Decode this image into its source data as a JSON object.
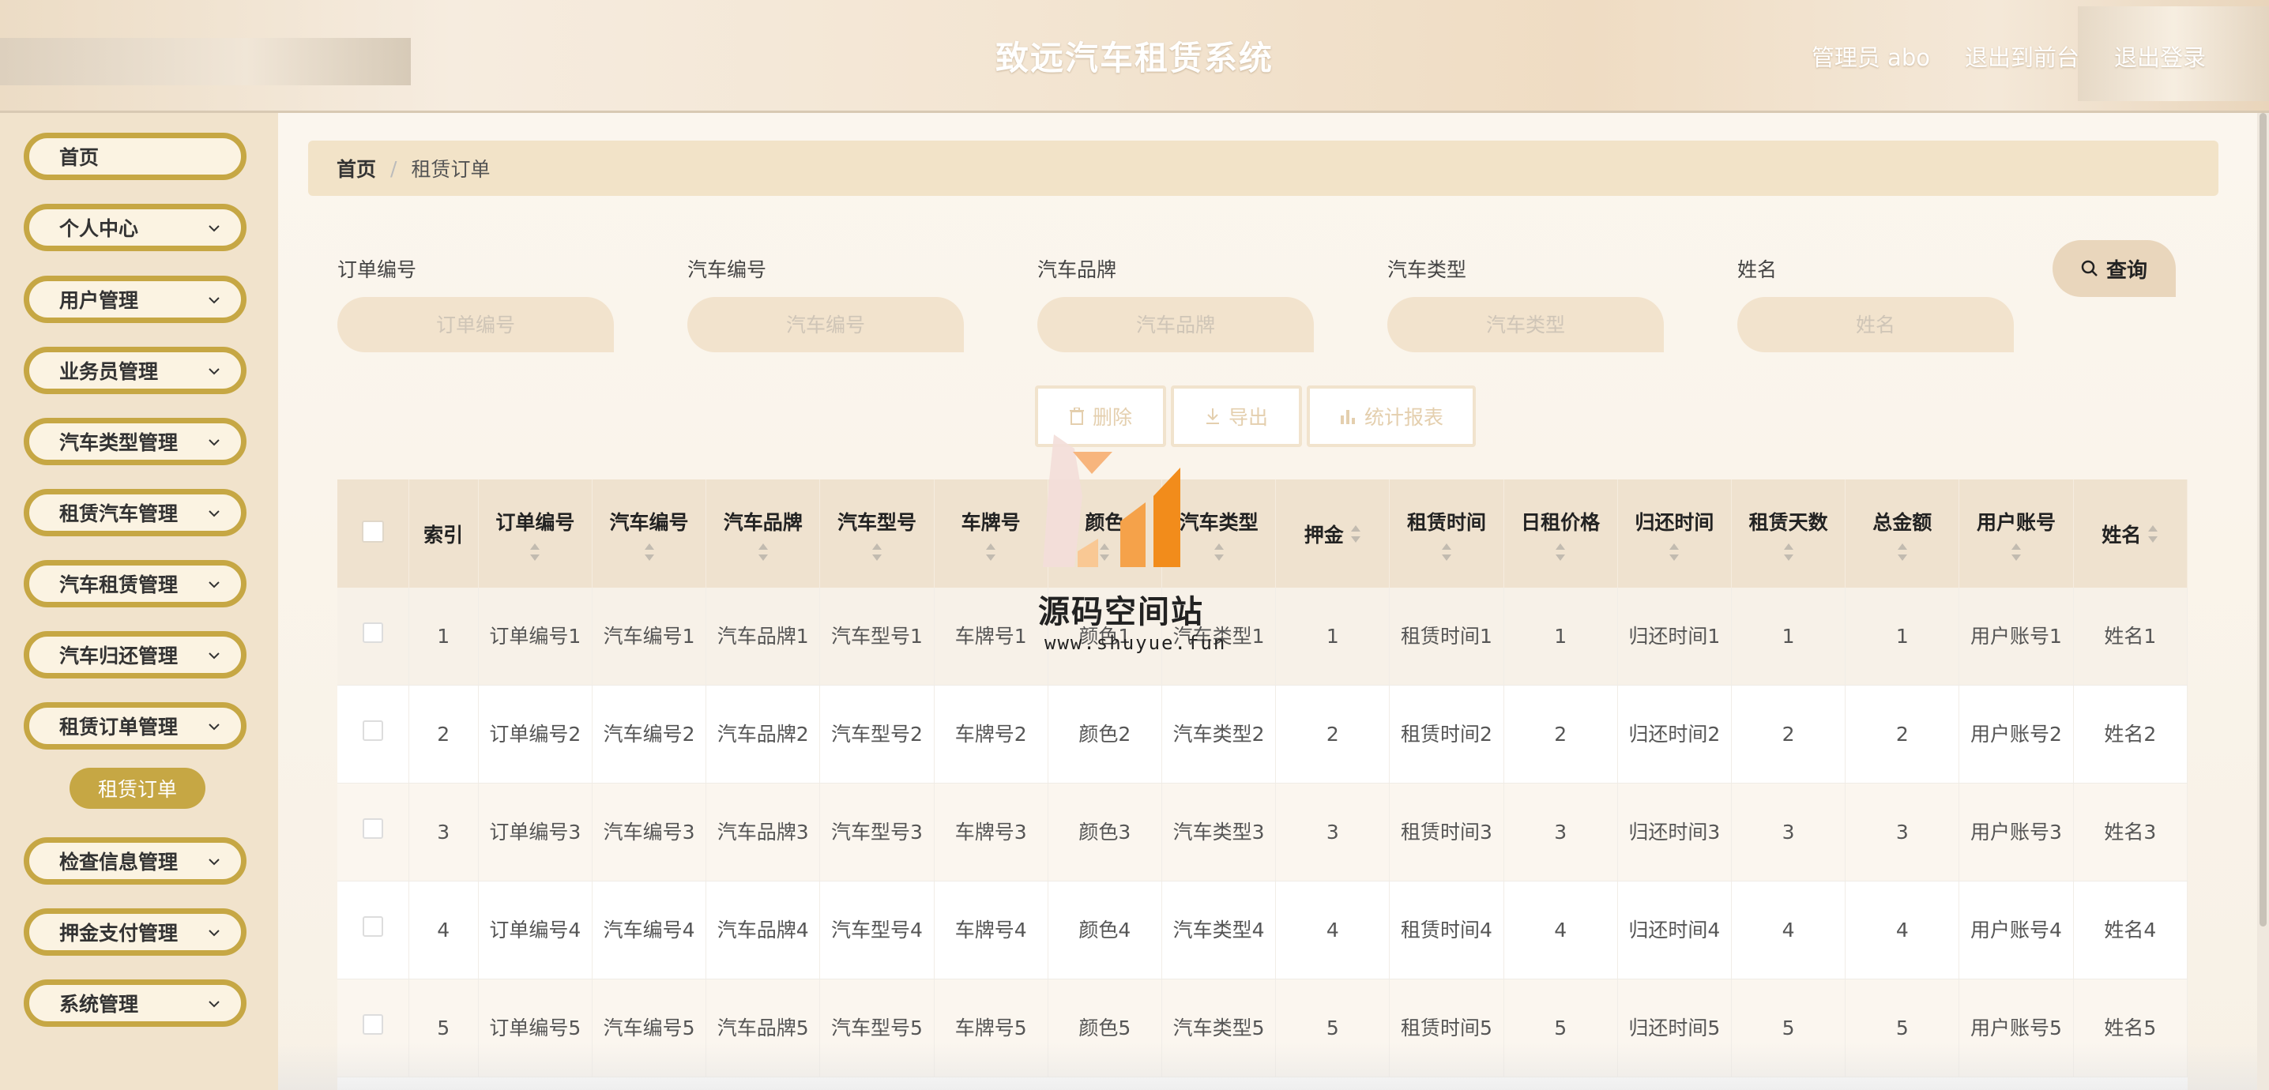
{
  "header": {
    "title": "致远汽车租赁系统",
    "user_label": "管理员 abo",
    "front_link": "退出到前台",
    "logout_link": "退出登录"
  },
  "sidebar": {
    "items": [
      {
        "label": "首页",
        "expandable": false
      },
      {
        "label": "个人中心",
        "expandable": true
      },
      {
        "label": "用户管理",
        "expandable": true
      },
      {
        "label": "业务员管理",
        "expandable": true
      },
      {
        "label": "汽车类型管理",
        "expandable": true
      },
      {
        "label": "租赁汽车管理",
        "expandable": true
      },
      {
        "label": "汽车租赁管理",
        "expandable": true
      },
      {
        "label": "汽车归还管理",
        "expandable": true
      },
      {
        "label": "租赁订单管理",
        "expandable": true
      },
      {
        "label": "检查信息管理",
        "expandable": true
      },
      {
        "label": "押金支付管理",
        "expandable": true
      },
      {
        "label": "系统管理",
        "expandable": true
      }
    ],
    "active_sub": "租赁订单"
  },
  "breadcrumb": {
    "home": "首页",
    "separator": "/",
    "current": "租赁订单"
  },
  "search": {
    "fields": [
      {
        "label": "订单编号",
        "placeholder": "订单编号"
      },
      {
        "label": "汽车编号",
        "placeholder": "汽车编号"
      },
      {
        "label": "汽车品牌",
        "placeholder": "汽车品牌"
      },
      {
        "label": "汽车类型",
        "placeholder": "汽车类型"
      },
      {
        "label": "姓名",
        "placeholder": "姓名"
      }
    ],
    "query_label": "查询"
  },
  "actions": {
    "delete": "删除",
    "export": "导出",
    "report": "统计报表"
  },
  "table": {
    "columns": [
      "索引",
      "订单编号",
      "汽车编号",
      "汽车品牌",
      "汽车型号",
      "车牌号",
      "颜色",
      "汽车类型",
      "押金",
      "租赁时间",
      "日租价格",
      "归还时间",
      "租赁天数",
      "总金额",
      "用户账号",
      "姓名"
    ],
    "rows": [
      [
        "1",
        "订单编号1",
        "汽车编号1",
        "汽车品牌1",
        "汽车型号1",
        "车牌号1",
        "颜色1",
        "汽车类型1",
        "1",
        "租赁时间1",
        "1",
        "归还时间1",
        "1",
        "1",
        "用户账号1",
        "姓名1"
      ],
      [
        "2",
        "订单编号2",
        "汽车编号2",
        "汽车品牌2",
        "汽车型号2",
        "车牌号2",
        "颜色2",
        "汽车类型2",
        "2",
        "租赁时间2",
        "2",
        "归还时间2",
        "2",
        "2",
        "用户账号2",
        "姓名2"
      ],
      [
        "3",
        "订单编号3",
        "汽车编号3",
        "汽车品牌3",
        "汽车型号3",
        "车牌号3",
        "颜色3",
        "汽车类型3",
        "3",
        "租赁时间3",
        "3",
        "归还时间3",
        "3",
        "3",
        "用户账号3",
        "姓名3"
      ],
      [
        "4",
        "订单编号4",
        "汽车编号4",
        "汽车品牌4",
        "汽车型号4",
        "车牌号4",
        "颜色4",
        "汽车类型4",
        "4",
        "租赁时间4",
        "4",
        "归还时间4",
        "4",
        "4",
        "用户账号4",
        "姓名4"
      ],
      [
        "5",
        "订单编号5",
        "汽车编号5",
        "汽车品牌5",
        "汽车型号5",
        "车牌号5",
        "颜色5",
        "汽车类型5",
        "5",
        "租赁时间5",
        "5",
        "归还时间5",
        "5",
        "5",
        "用户账号5",
        "姓名5"
      ]
    ]
  },
  "watermark": {
    "title": "源码空间站",
    "url": "www.shuyue.fun"
  },
  "colors": {
    "accent_gold": "#c6a744",
    "header_bg": "#efe2cf",
    "sidebar_bg": "#f1e3cc",
    "logo_orange": "#f28c1b"
  }
}
